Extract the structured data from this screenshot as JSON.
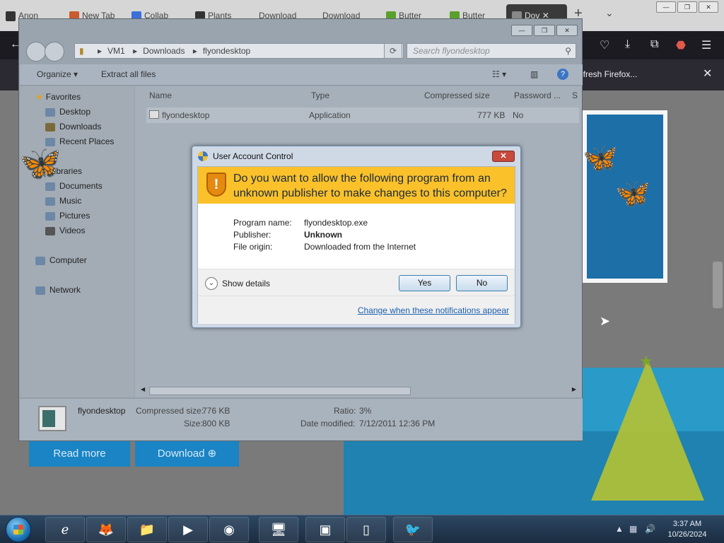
{
  "firefox": {
    "tabs": [
      "Anon",
      "New Tab",
      "Collab",
      "Plants",
      "Download",
      "Download",
      "Butter",
      "Butter",
      "Dov"
    ],
    "notification": "efresh Firefox...",
    "webpage": {
      "read_more": "Read more",
      "download": "Download"
    }
  },
  "explorer": {
    "breadcrumb": [
      "VM1",
      "Downloads",
      "flyondesktop"
    ],
    "search_placeholder": "Search flyondesktop",
    "toolbar": {
      "organize": "Organize",
      "extract": "Extract all files"
    },
    "nav": {
      "favorites": "Favorites",
      "desktop": "Desktop",
      "downloads": "Downloads",
      "recent": "Recent Places",
      "libraries": "Libraries",
      "documents": "Documents",
      "music": "Music",
      "pictures": "Pictures",
      "videos": "Videos",
      "computer": "Computer",
      "network": "Network"
    },
    "columns": [
      "Name",
      "Type",
      "Compressed size",
      "Password ...",
      "S"
    ],
    "files": [
      {
        "name": "flyondesktop",
        "type": "Application",
        "size": "777 KB",
        "password": "No"
      }
    ],
    "details": {
      "name": "flyondesktop",
      "compressed_label": "Compressed size:",
      "compressed_value": "776 KB",
      "size_label": "Size:",
      "size_value": "800 KB",
      "ratio_label": "Ratio:",
      "ratio_value": "3%",
      "date_label": "Date modified:",
      "date_value": "7/12/2011 12:36 PM"
    }
  },
  "uac": {
    "title": "User Account Control",
    "question": "Do you want to allow the following program from an unknown publisher to make changes to this computer?",
    "program_label": "Program name:",
    "program_value": "flyondesktop.exe",
    "publisher_label": "Publisher:",
    "publisher_value": "Unknown",
    "origin_label": "File origin:",
    "origin_value": "Downloaded from the Internet",
    "show_details": "Show details",
    "yes": "Yes",
    "no": "No",
    "link": "Change when these notifications appear"
  },
  "taskbar": {
    "time": "3:37 AM",
    "date": "10/26/2024"
  }
}
